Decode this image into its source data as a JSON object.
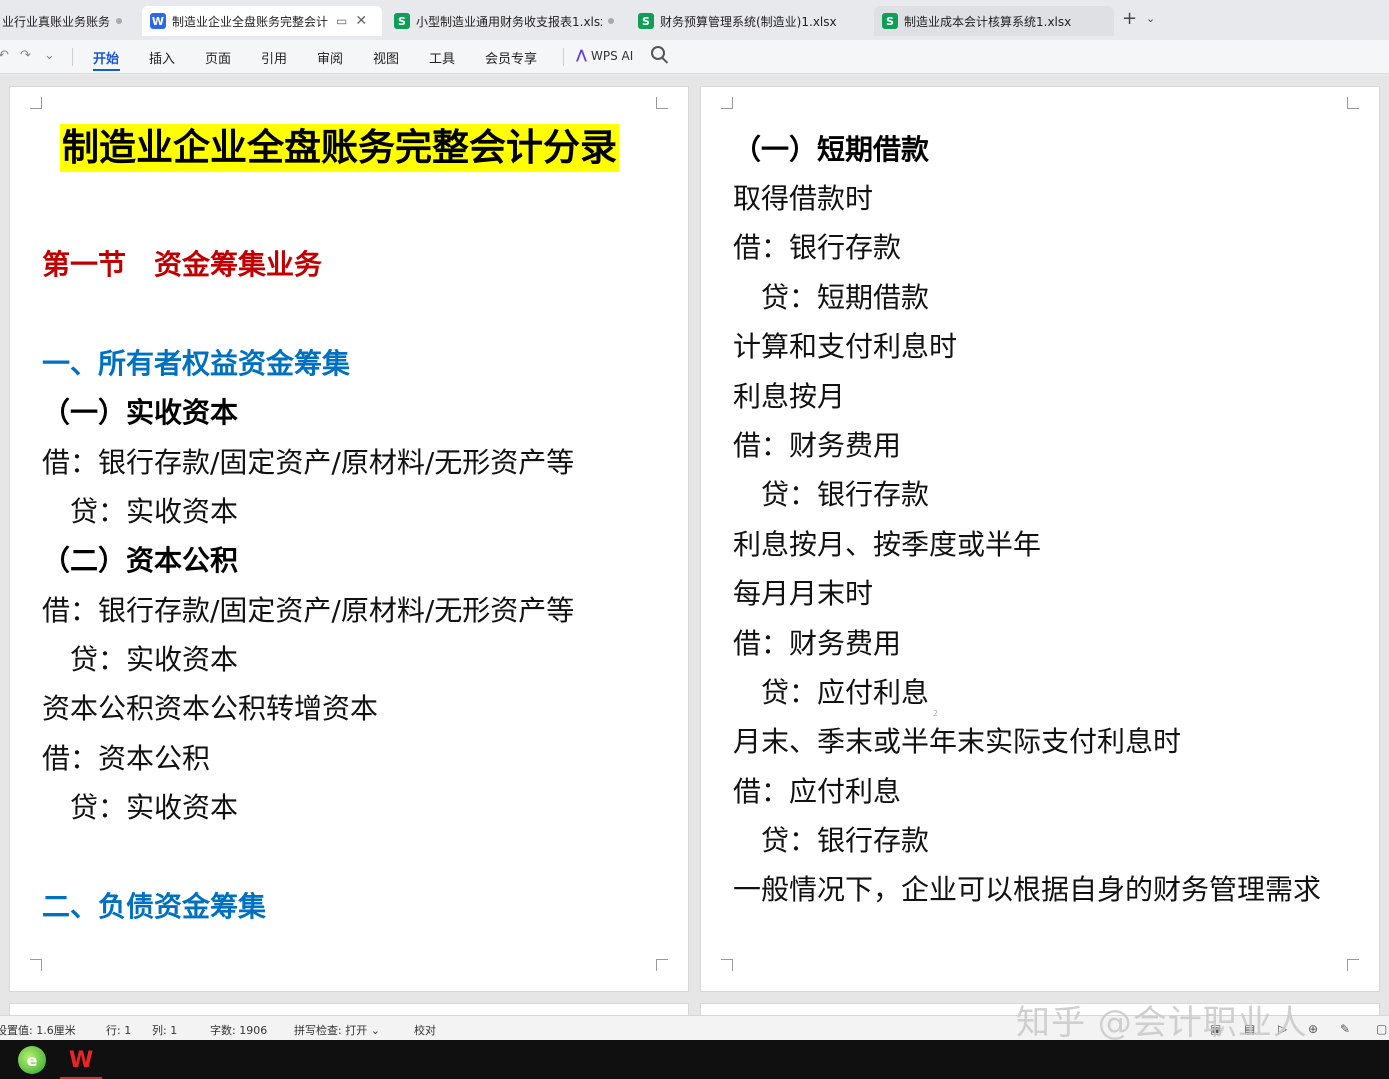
{
  "tabs": [
    {
      "title": "业行业真账业务账务",
      "type": "",
      "active": false
    },
    {
      "title": "制造业企业全盘账务完整会计",
      "type": "W",
      "active": true
    },
    {
      "title": "小型制造业通用财务收支报表1.xlsx",
      "type": "S",
      "active": false
    },
    {
      "title": "财务预算管理系统(制造业)1.xlsx",
      "type": "S",
      "active": false
    },
    {
      "title": "制造业成本会计核算系统1.xlsx",
      "type": "S",
      "active": false
    }
  ],
  "ribbon": {
    "menus": [
      "开始",
      "插入",
      "页面",
      "引用",
      "审阅",
      "视图",
      "工具",
      "会员专享"
    ],
    "wps_ai": "WPS AI"
  },
  "page1": {
    "title": "制造业企业全盘账务完整会计分录",
    "section1": "第一节　资金筹集业务",
    "heading1": "一、所有者权益资金筹集",
    "sub1": "（一）实收资本",
    "l1": "借：银行存款/固定资产/原材料/无形资产等",
    "l2": "贷：实收资本",
    "sub2": "（二）资本公积",
    "l3": "借：银行存款/固定资产/原材料/无形资产等",
    "l4": "贷：实收资本",
    "l5": "资本公积资本公积转增资本",
    "l6": "借：资本公积",
    "l7": "贷：实收资本",
    "heading2": "二、负债资金筹集"
  },
  "page2": {
    "sub1": "（一）短期借款",
    "lines": [
      "取得借款时",
      "借：银行存款",
      "贷：短期借款",
      "计算和支付利息时",
      "利息按月",
      "借：财务费用",
      "贷：银行存款",
      "利息按月、按季度或半年",
      "每月月末时",
      "借：财务费用",
      "贷：应付利息",
      "月末、季末或半年末实际支付利息时",
      "借：应付利息",
      "贷：银行存款",
      "一般情况下，企业可以根据自身的财务管理需求"
    ],
    "mark": "2"
  },
  "status": {
    "setting": "设置值: 1.6厘米",
    "row": "行: 1",
    "col": "列: 1",
    "words": "字数: 1906",
    "spell": "拼写检查: 打开 ⌄",
    "proof": "校对"
  },
  "watermark": "知乎 @会计职业人",
  "taskbar": {
    "browser_glyph": "e",
    "wps_glyph": "W"
  },
  "colors": {
    "highlight": "#ffff00",
    "section_red": "#c00000",
    "heading_blue": "#0070c0",
    "accent": "#1a57d6"
  }
}
